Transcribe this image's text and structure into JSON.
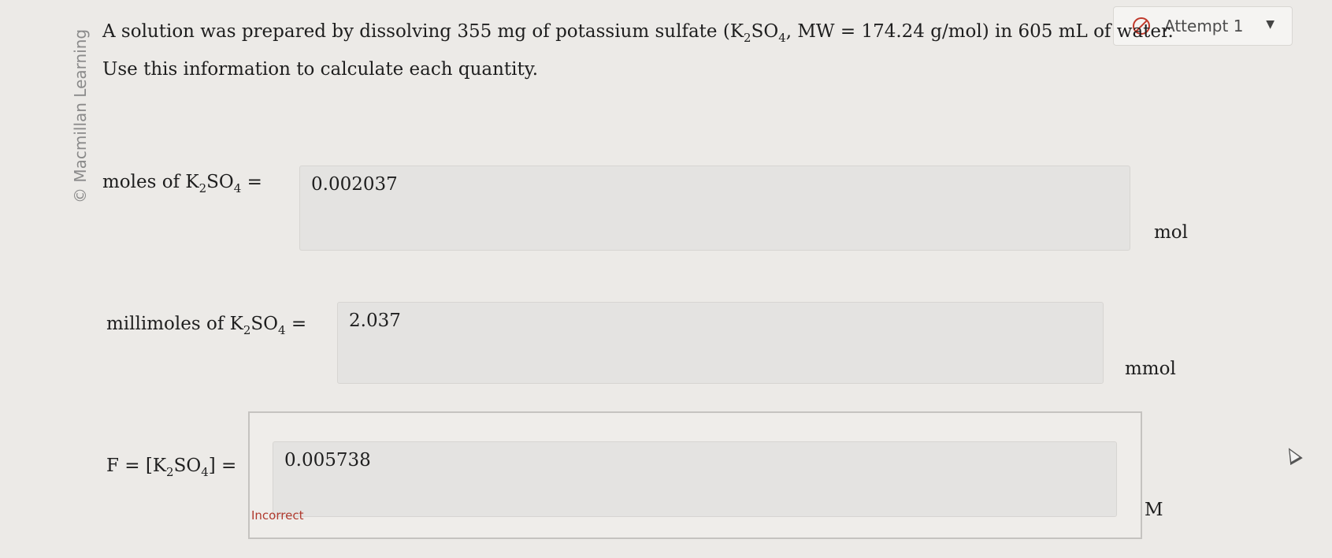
{
  "credit": "© Macmillan Learning",
  "attempt": {
    "label": "Attempt 1"
  },
  "question": {
    "part1": "A solution was prepared by dissolving 355 mg of potassium sulfate (K",
    "sub1": "2",
    "part2": "SO",
    "sub2": "4",
    "part3": ", MW = 174.24 g/mol) in 605 mL of water. Use this information to calculate each quantity."
  },
  "rows": [
    {
      "prefix": "moles of K",
      "s1": "2",
      "mid": "SO",
      "s2": "4",
      "suffix": " =",
      "value": "0.002037",
      "unit": "mol"
    },
    {
      "prefix": "millimoles of K",
      "s1": "2",
      "mid": "SO",
      "s2": "4",
      "suffix": " =",
      "value": "2.037",
      "unit": "mmol"
    },
    {
      "prefix": "F = [K",
      "s1": "2",
      "mid": "SO",
      "s2": "4",
      "suffix": "] =",
      "value": "0.005738",
      "unit": "M",
      "feedback": "Incorrect"
    }
  ]
}
